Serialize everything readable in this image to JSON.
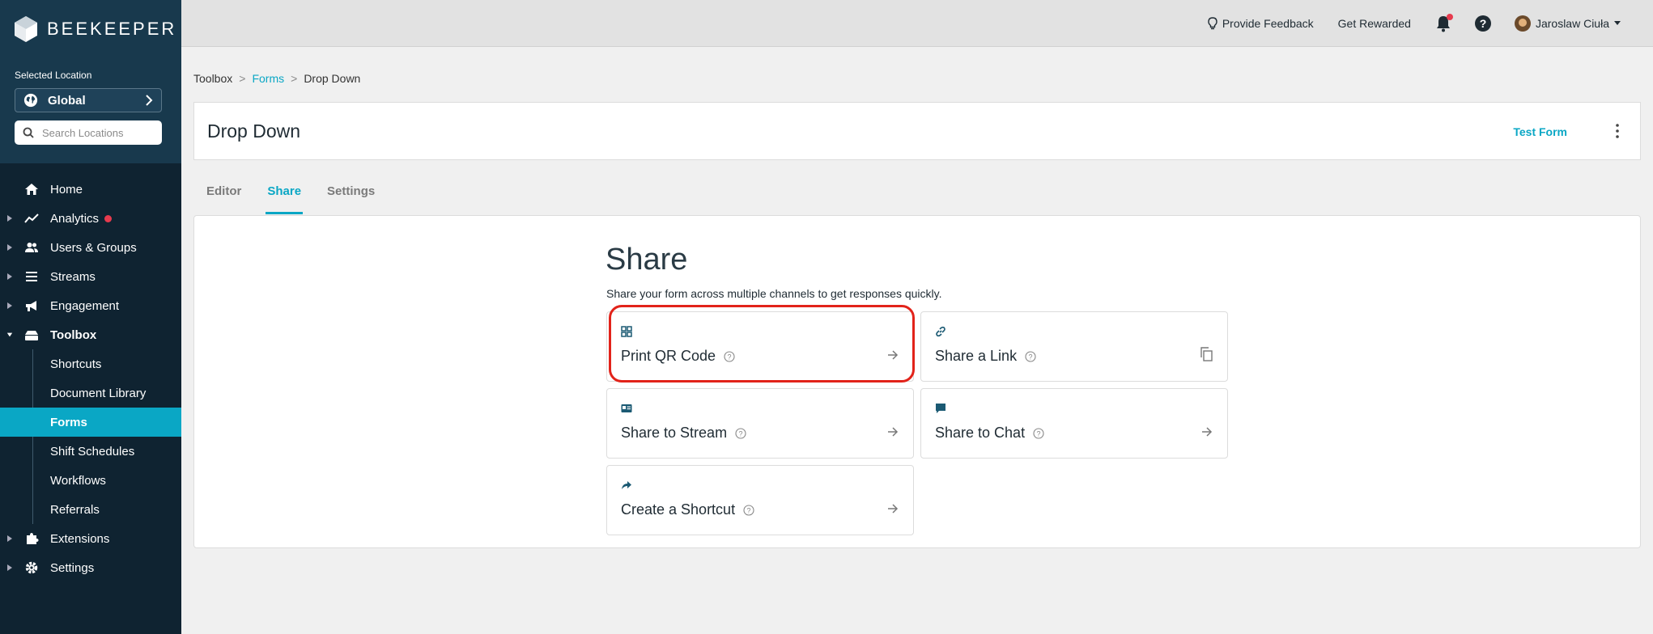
{
  "brand": {
    "name": "BEEKEEPER"
  },
  "location": {
    "label": "Selected Location",
    "current": "Global",
    "search_placeholder": "Search Locations"
  },
  "nav": {
    "home": "Home",
    "analytics": "Analytics",
    "users_groups": "Users & Groups",
    "streams": "Streams",
    "engagement": "Engagement",
    "toolbox": "Toolbox",
    "toolbox_items": {
      "shortcuts": "Shortcuts",
      "document_library": "Document Library",
      "forms": "Forms",
      "shift_schedules": "Shift Schedules",
      "workflows": "Workflows",
      "referrals": "Referrals"
    },
    "extensions": "Extensions",
    "settings": "Settings"
  },
  "topbar": {
    "feedback": "Provide Feedback",
    "rewarded": "Get Rewarded",
    "user_name": "Jaroslaw Ciuła"
  },
  "breadcrumb": {
    "root": "Toolbox",
    "parent": "Forms",
    "current": "Drop Down",
    "separator": ">"
  },
  "header": {
    "title": "Drop Down",
    "test_form": "Test Form"
  },
  "tabs": {
    "editor": "Editor",
    "share": "Share",
    "settings": "Settings"
  },
  "share": {
    "heading": "Share",
    "subtitle": "Share your form across multiple channels to get responses quickly.",
    "options": {
      "qr": "Print QR Code",
      "link": "Share a Link",
      "stream": "Share to Stream",
      "chat": "Share to Chat",
      "shortcut": "Create a Shortcut"
    }
  },
  "colors": {
    "accent": "#0aa7c5",
    "sidebar": "#0f2331",
    "alert": "#e73b4e",
    "highlight": "#e2231a"
  }
}
